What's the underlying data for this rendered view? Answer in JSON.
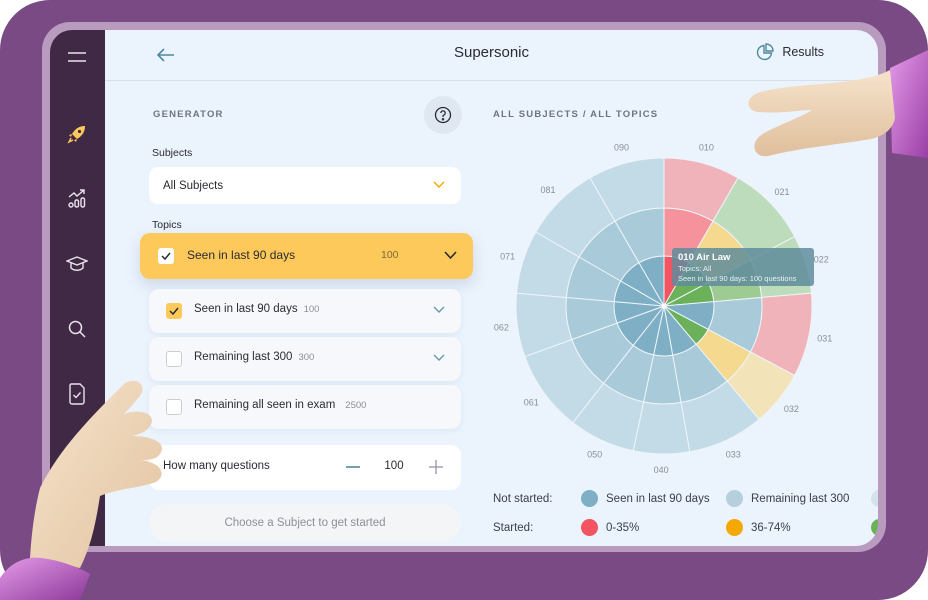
{
  "app": {
    "title": "Supersonic",
    "back_icon": "arrow-left-icon",
    "results_label": "Results",
    "results_icon": "pie-chart-icon"
  },
  "sidebar": {
    "items": [
      {
        "name": "menu",
        "icon": "hamburger-menu-icon"
      },
      {
        "name": "generator",
        "icon": "rocket-icon",
        "active": true
      },
      {
        "name": "statistics",
        "icon": "chart-trend-icon"
      },
      {
        "name": "learning",
        "icon": "graduation-cap-icon"
      },
      {
        "name": "search",
        "icon": "search-icon"
      },
      {
        "name": "exams",
        "icon": "document-check-icon"
      }
    ]
  },
  "generator": {
    "heading": "GENERATOR",
    "help_icon": "question-circle-icon",
    "subjects_label": "Subjects",
    "subjects_value": "All Subjects",
    "topics_label": "Topics",
    "selected_topic": {
      "label": "Seen in last 90 days",
      "count": "100",
      "checked": true
    },
    "topic_options": [
      {
        "label": "Seen in last 90 days",
        "count": "100",
        "checked": true,
        "expandable": true
      },
      {
        "label": "Remaining last 300",
        "count": "300",
        "checked": false,
        "expandable": true
      },
      {
        "label": "Remaining all seen in exam",
        "count": "2500",
        "checked": false,
        "expandable": false
      }
    ],
    "questions_label": "How many questions",
    "questions_value": "100",
    "start_label": "Choose a Subject to get started"
  },
  "chart_panel": {
    "heading": "ALL SUBJECTS / ALL TOPICS",
    "tooltip": {
      "title": "010 Air Law",
      "line1": "Topics: All",
      "line2": "Seen in last 90 days: 100 questions"
    },
    "legend": {
      "not_started_label": "Not started:",
      "started_label": "Started:",
      "not_started": [
        {
          "label": "Seen in last 90 days",
          "color": "#7eafc4"
        },
        {
          "label": "Remaining last 300",
          "color": "#b5d0dc"
        },
        {
          "label": "",
          "color": "#d3e3ea"
        }
      ],
      "started": [
        {
          "label": "0-35%",
          "color": "#f25461"
        },
        {
          "label": "36-74%",
          "color": "#f5a800"
        },
        {
          "label": "",
          "color": "#6ab15a"
        }
      ]
    }
  },
  "chart_data": {
    "type": "sunburst",
    "title": "ALL SUBJECTS / ALL TOPICS",
    "rings": [
      "Seen in last 90 days",
      "Remaining last 300",
      "Remaining all seen in exam"
    ],
    "subjects": [
      {
        "code": "010",
        "start": 0,
        "end": 30,
        "status": [
          "red",
          "red",
          "red"
        ]
      },
      {
        "code": "021",
        "start": 30,
        "end": 62,
        "status": [
          "green",
          "yellow",
          "green"
        ]
      },
      {
        "code": "022",
        "start": 62,
        "end": 85,
        "status": [
          "green",
          "green",
          "green"
        ]
      },
      {
        "code": "031",
        "start": 85,
        "end": 118,
        "status": [
          "blue",
          "blue",
          "red"
        ]
      },
      {
        "code": "032",
        "start": 118,
        "end": 140,
        "status": [
          "green",
          "yellow",
          "yellow"
        ]
      },
      {
        "code": "033",
        "start": 140,
        "end": 170,
        "status": [
          "blue",
          "blue",
          "blue"
        ]
      },
      {
        "code": "040",
        "start": 170,
        "end": 192,
        "status": [
          "blue",
          "blue",
          "blue"
        ]
      },
      {
        "code": "050",
        "start": 192,
        "end": 218,
        "status": [
          "blue",
          "blue",
          "blue"
        ]
      },
      {
        "code": "061",
        "start": 218,
        "end": 250,
        "status": [
          "blue",
          "blue",
          "blue"
        ]
      },
      {
        "code": "062",
        "start": 250,
        "end": 275,
        "status": [
          "blue",
          "blue",
          "blue"
        ]
      },
      {
        "code": "071",
        "start": 275,
        "end": 300,
        "status": [
          "blue",
          "blue",
          "blue"
        ]
      },
      {
        "code": "081",
        "start": 300,
        "end": 330,
        "status": [
          "blue",
          "blue",
          "blue"
        ]
      },
      {
        "code": "090",
        "start": 330,
        "end": 360,
        "status": [
          "blue",
          "blue",
          "blue"
        ]
      }
    ],
    "highlighted": "010"
  }
}
